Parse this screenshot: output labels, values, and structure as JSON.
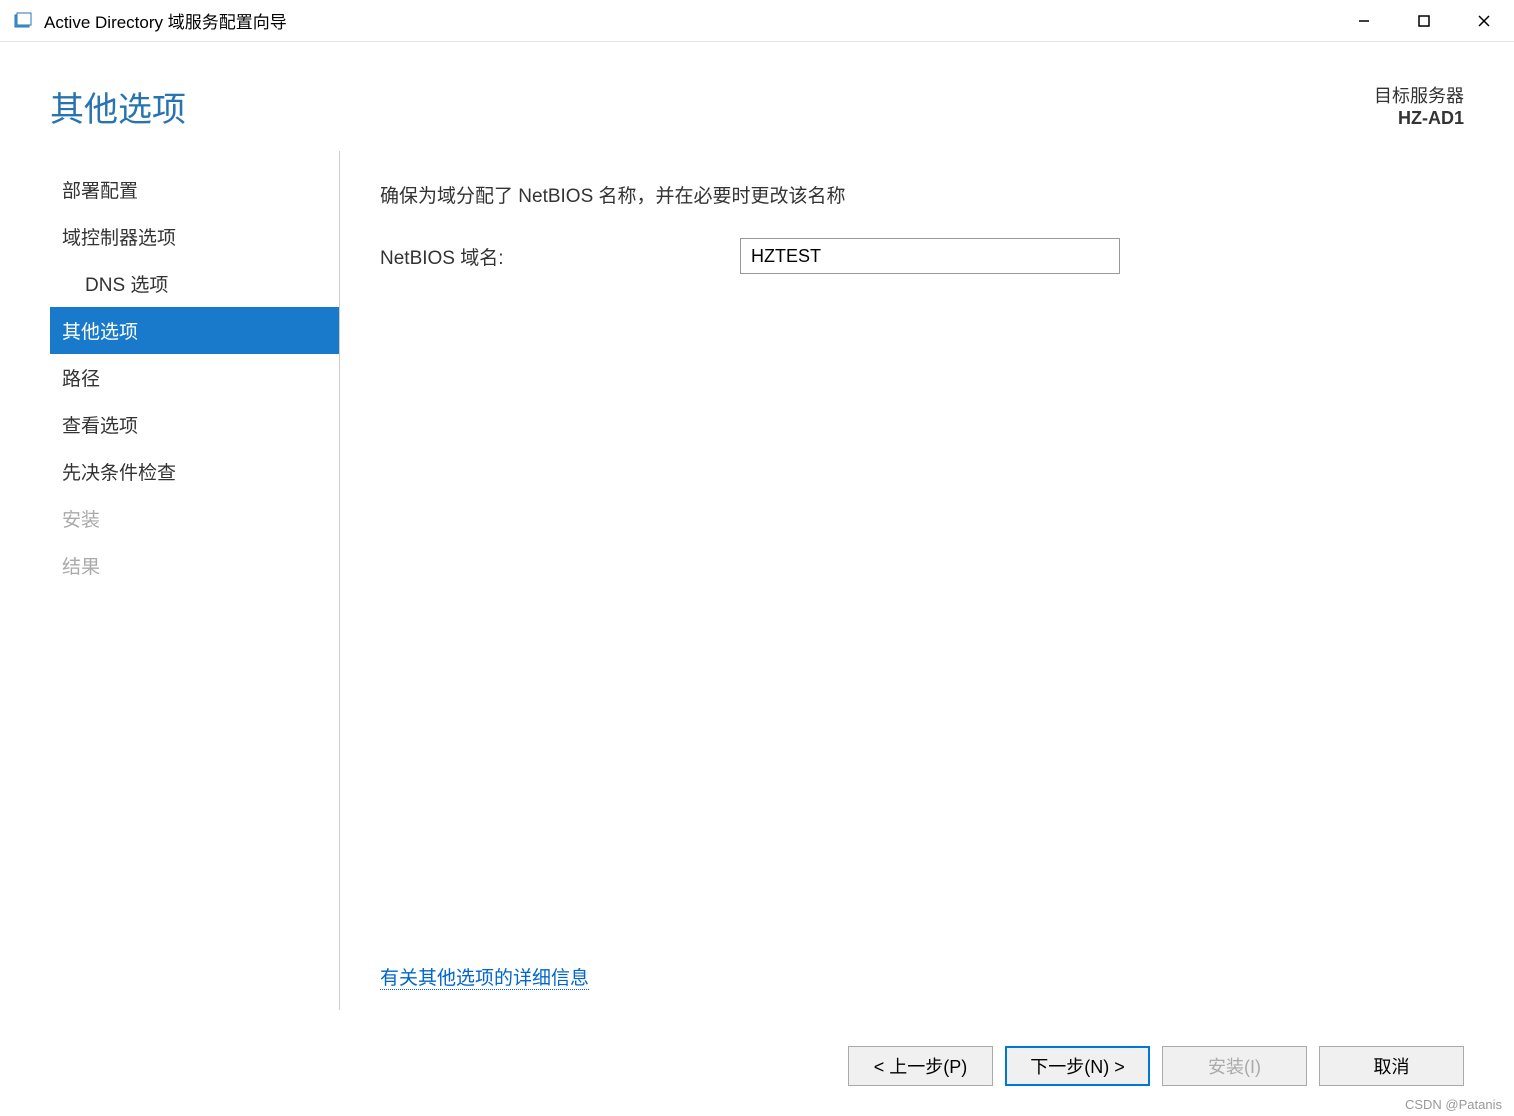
{
  "window": {
    "title": "Active Directory 域服务配置向导"
  },
  "header": {
    "title": "其他选项",
    "target_label": "目标服务器",
    "target_server": "HZ-AD1"
  },
  "sidebar": {
    "items": [
      {
        "label": "部署配置",
        "selected": false,
        "disabled": false,
        "indent": false
      },
      {
        "label": "域控制器选项",
        "selected": false,
        "disabled": false,
        "indent": false
      },
      {
        "label": "DNS 选项",
        "selected": false,
        "disabled": false,
        "indent": true
      },
      {
        "label": "其他选项",
        "selected": true,
        "disabled": false,
        "indent": false
      },
      {
        "label": "路径",
        "selected": false,
        "disabled": false,
        "indent": false
      },
      {
        "label": "查看选项",
        "selected": false,
        "disabled": false,
        "indent": false
      },
      {
        "label": "先决条件检查",
        "selected": false,
        "disabled": false,
        "indent": false
      },
      {
        "label": "安装",
        "selected": false,
        "disabled": true,
        "indent": false
      },
      {
        "label": "结果",
        "selected": false,
        "disabled": true,
        "indent": false
      }
    ]
  },
  "main": {
    "instruction": "确保为域分配了 NetBIOS 名称，并在必要时更改该名称",
    "netbios_label": "NetBIOS 域名:",
    "netbios_value": "HZTEST",
    "help_link": "有关其他选项的详细信息"
  },
  "buttons": {
    "previous": "< 上一步(P)",
    "next": "下一步(N) >",
    "install": "安装(I)",
    "cancel": "取消"
  },
  "credit": "CSDN @Patanis"
}
